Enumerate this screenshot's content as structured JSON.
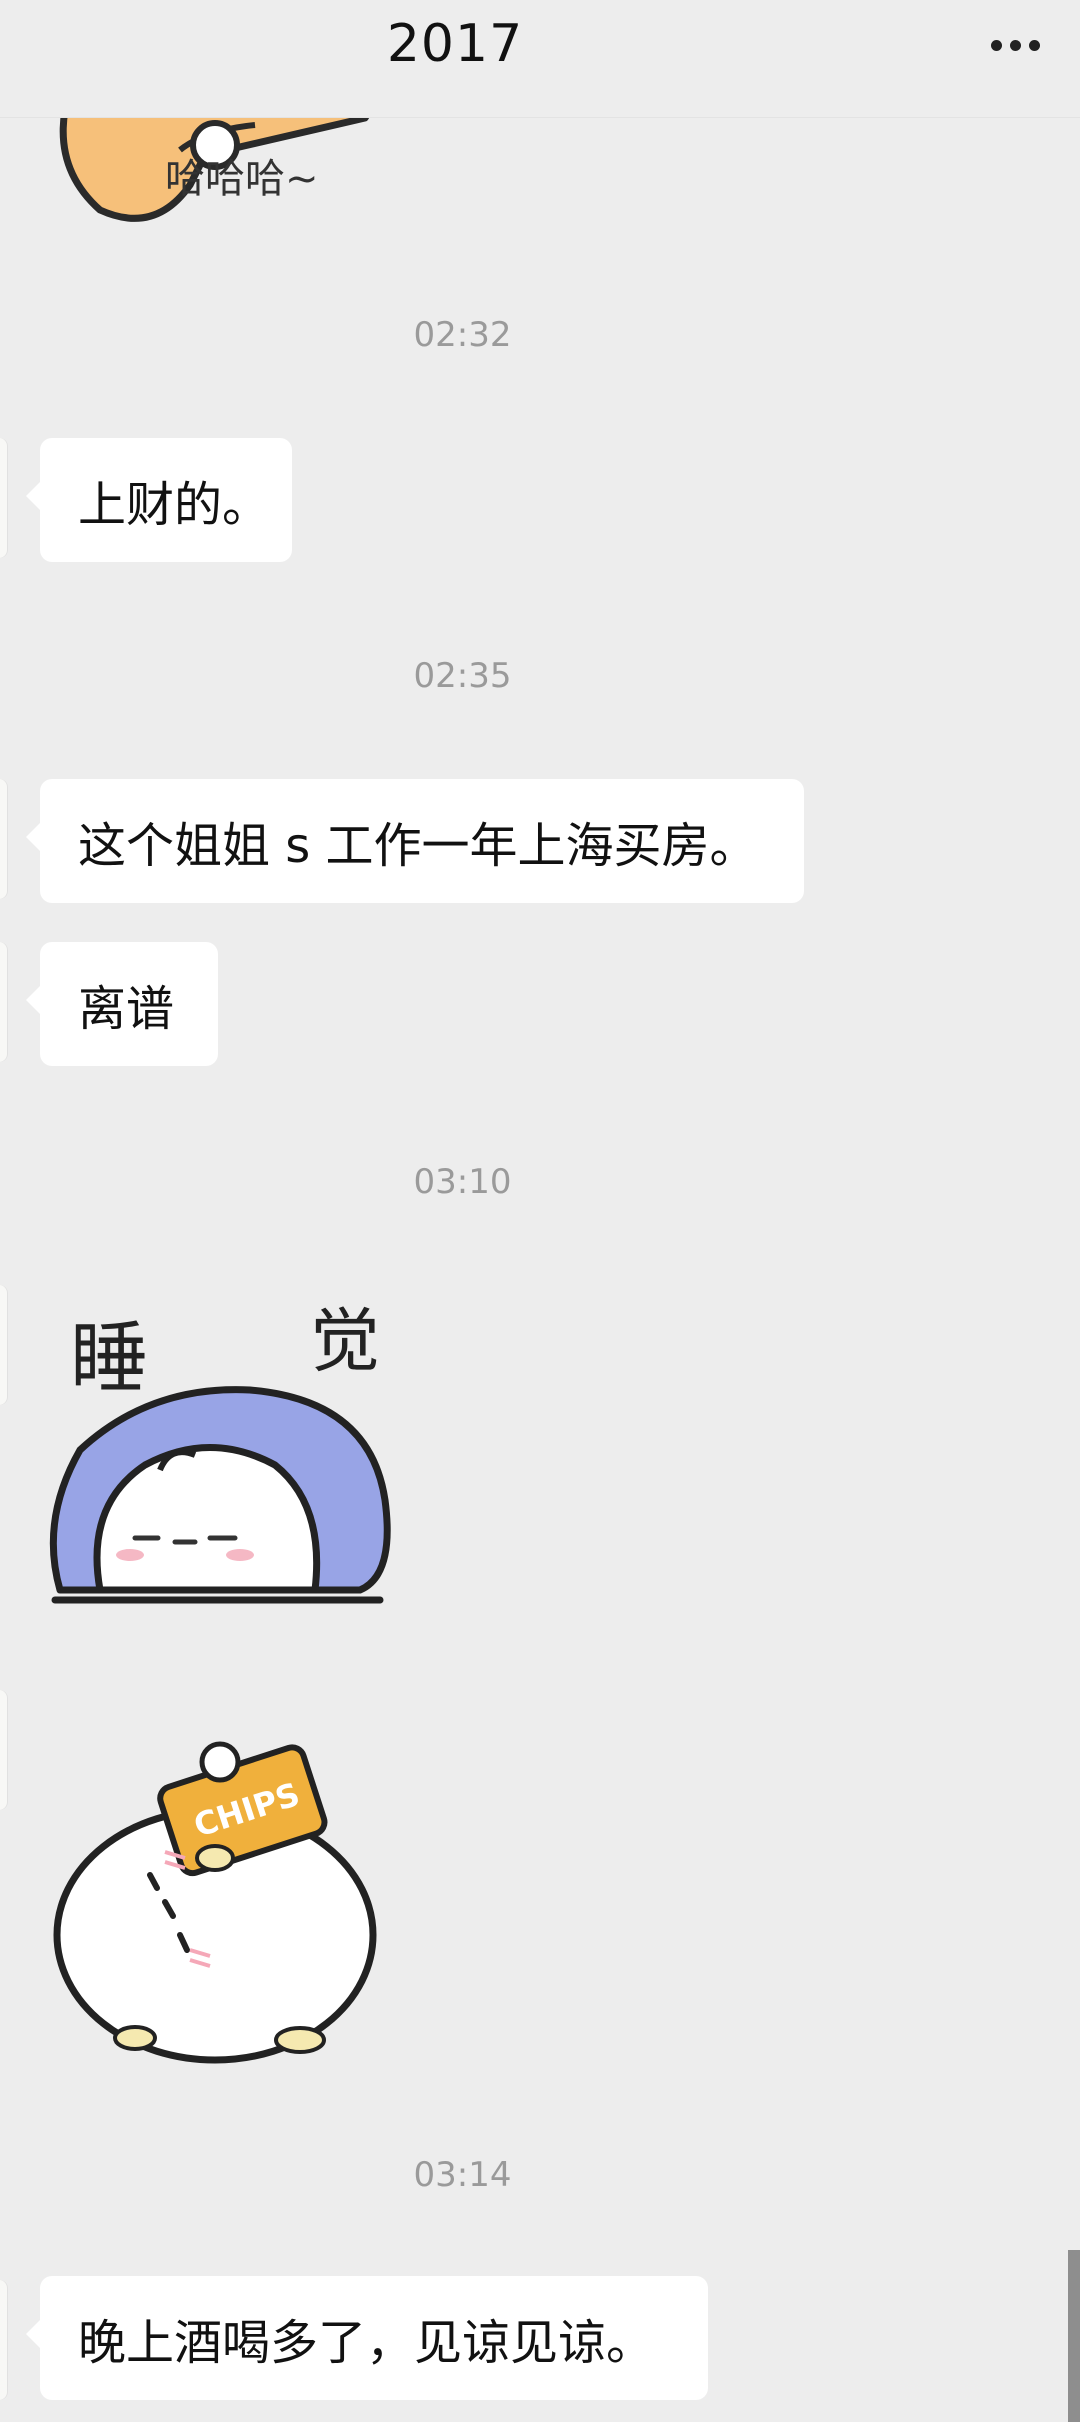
{
  "header": {
    "title": "2017",
    "more_icon": "more-horizontal-icon"
  },
  "messages": {
    "sticker_top_text": "哈哈哈~",
    "time_1": "02:32",
    "msg_1": "上财的。",
    "time_2": "02:35",
    "msg_2": "这个姐姐 s 工作一年上海买房。",
    "msg_3": "离谱",
    "time_3": "03:10",
    "sticker_sleep_text_1": "睡",
    "sticker_sleep_text_2": "觉",
    "sticker_chips_text": "CHIPS",
    "time_4": "03:14",
    "msg_4": "晚上酒喝多了，见谅见谅。"
  },
  "colors": {
    "background": "#ededed",
    "bubble": "#ffffff",
    "timestamp": "#9a9a9a",
    "blanket": "#98a4e6",
    "chips_bag": "#f0b03c"
  }
}
